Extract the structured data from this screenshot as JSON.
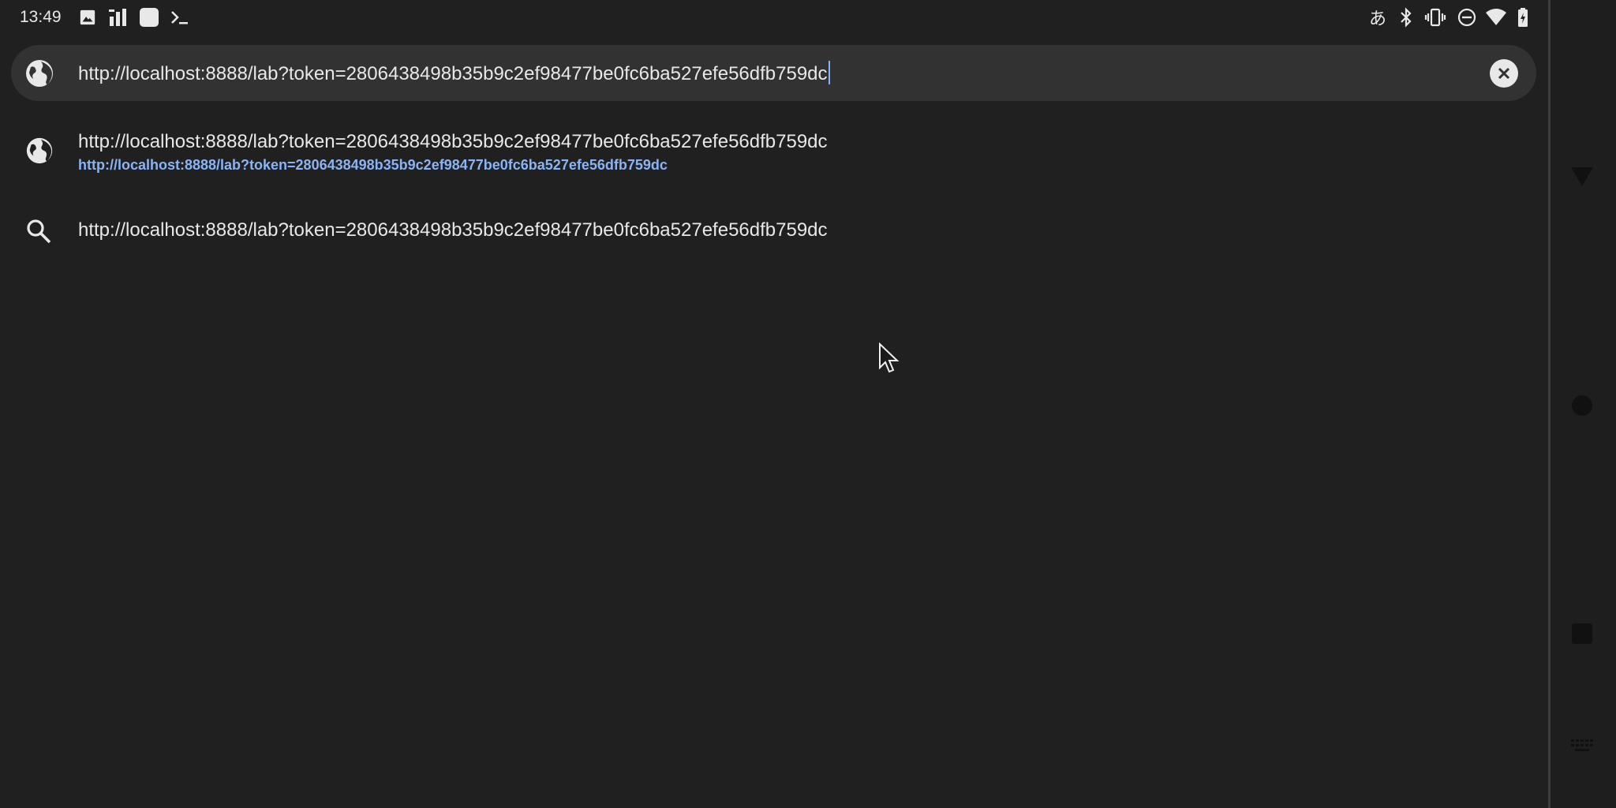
{
  "status_bar": {
    "time": "13:49",
    "left_icons": [
      "image-icon",
      "signal-bars-icon",
      "square-app-icon",
      "terminal-icon"
    ],
    "right_icons": [
      "japanese-input-icon",
      "bluetooth-icon",
      "vibrate-icon",
      "do-not-disturb-icon",
      "wifi-icon",
      "battery-icon"
    ],
    "ime_glyph": "あ"
  },
  "omnibox": {
    "value": "http://localhost:8888/lab?token=2806438498b35b9c2ef98477be0fc6ba527efe56dfb759dc",
    "clear_icon": "clear-icon"
  },
  "suggestions": [
    {
      "icon": "globe-icon",
      "title": "http://localhost:8888/lab?token=2806438498b35b9c2ef98477be0fc6ba527efe56dfb759dc",
      "url": "http://localhost:8888/lab?token=2806438498b35b9c2ef98477be0fc6ba527efe56dfb759dc"
    },
    {
      "icon": "search-icon",
      "title": "http://localhost:8888/lab?token=2806438498b35b9c2ef98477be0fc6ba527efe56dfb759dc"
    }
  ],
  "nav_bar": {
    "buttons": [
      "back-icon",
      "home-icon",
      "recents-icon",
      "keyboard-icon"
    ]
  },
  "colors": {
    "background": "#202020",
    "omnibox": "#323232",
    "link": "#8ab4f8",
    "text": "#e8e8e8"
  }
}
